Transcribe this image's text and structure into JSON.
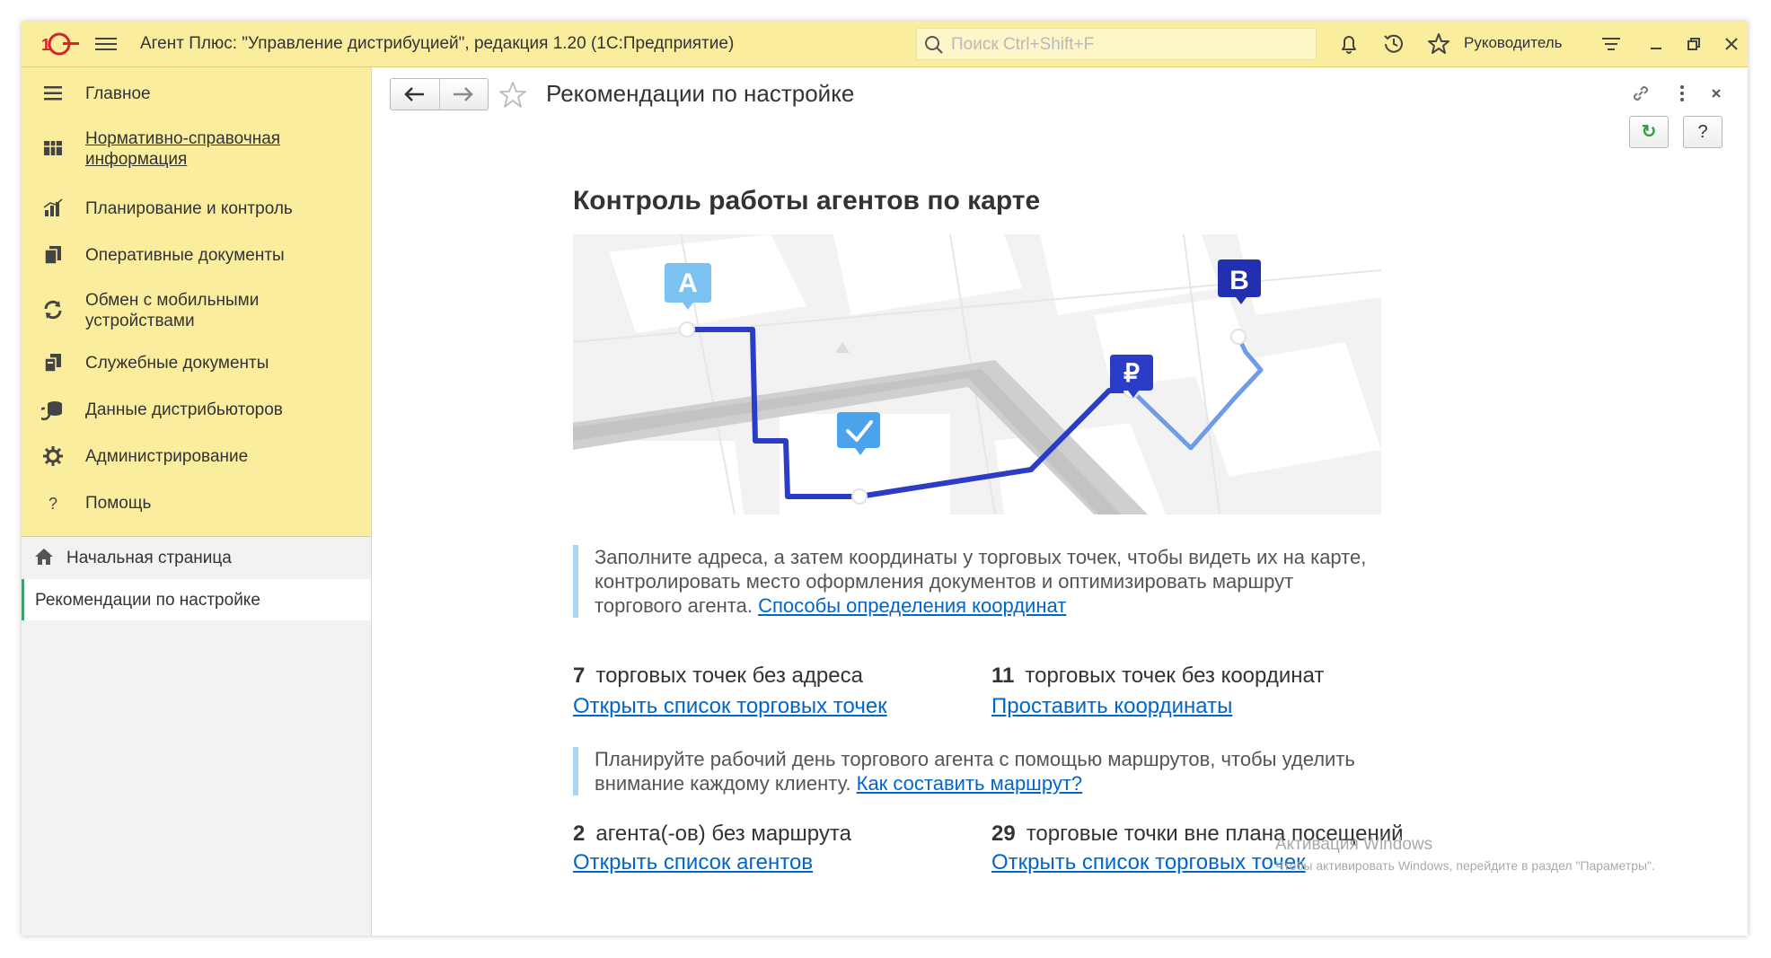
{
  "titlebar": {
    "app_title": "Агент Плюс: \"Управление дистрибуцией\", редакция 1.20  (1С:Предприятие)",
    "search_placeholder": "Поиск Ctrl+Shift+F",
    "user": "Руководитель",
    "accent_color": "#fbed9e"
  },
  "sidebar": {
    "sections": [
      {
        "label": "Главное",
        "icon": "menu-lines-icon"
      },
      {
        "label": "Нормативно-справочная информация",
        "icon": "catalog-icon"
      },
      {
        "label": "Планирование и контроль",
        "icon": "bar-chart-icon"
      },
      {
        "label": "Оперативные документы",
        "icon": "documents-icon"
      },
      {
        "label": "Обмен с мобильными устройствами",
        "icon": "sync-icon"
      },
      {
        "label": "Служебные документы",
        "icon": "service-documents-icon"
      },
      {
        "label": "Данные дистрибьюторов",
        "icon": "distributor-data-icon"
      },
      {
        "label": "Администрирование",
        "icon": "gear-icon"
      },
      {
        "label": "Помощь",
        "icon": "question-icon"
      }
    ],
    "open_windows": [
      {
        "label": "Начальная страница",
        "icon": "home-icon"
      },
      {
        "label": "Рекомендации по настройке"
      }
    ]
  },
  "content": {
    "page_title": "Рекомендации по настройке",
    "refresh_label": "↻",
    "help_label": "?",
    "heading": "Контроль работы агентов по карте",
    "map_markers": [
      "A",
      "B",
      "₽"
    ],
    "note1_text": "Заполните адреса, а затем координаты у торговых точек, чтобы видеть их на карте, контролировать место оформления документов и оптимизировать маршрут торгового агента. ",
    "note1_link": "Способы определения координат",
    "stat1_count": "7",
    "stat1_text": "торговых точек без адреса",
    "stat1_link": "Открыть список торговых точек",
    "stat2_count": "11",
    "stat2_text": "торговых точек без координат",
    "stat2_link": "Проставить координаты",
    "note2_text": "Планируйте рабочий день торгового агента с помощью маршрутов, чтобы уделить внимание каждому клиенту. ",
    "note2_link": "Как составить маршрут?",
    "stat3_count": "2",
    "stat3_text": "агента(-ов) без маршрута",
    "stat3_link": "Открыть список агентов",
    "stat4_count": "29",
    "stat4_text": "торговые точки вне плана посещений",
    "stat4_link": "Открыть список торговых точек"
  },
  "watermark": {
    "line1": "Активация Windows",
    "line2": "Чтобы активировать Windows, перейдите в раздел \"Параметры\"."
  }
}
